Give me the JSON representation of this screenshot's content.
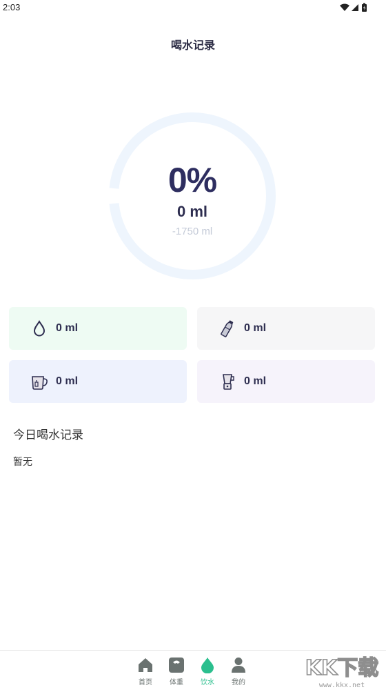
{
  "status_bar": {
    "time": "2:03"
  },
  "header": {
    "title": "喝水记录"
  },
  "progress": {
    "percent_label": "0%",
    "fraction": 0,
    "amount_label": "0 ml",
    "remaining_label": "-1750 ml",
    "ring_color": "#eef5fd"
  },
  "cards": [
    {
      "icon": "water-drop-icon",
      "value": "0 ml",
      "bg": "#eefbf3"
    },
    {
      "icon": "water-bottle-icon",
      "value": "0 ml",
      "bg": "#f6f6f7"
    },
    {
      "icon": "cup-icon",
      "value": "0 ml",
      "bg": "#eef2fd"
    },
    {
      "icon": "blender-cup-icon",
      "value": "0 ml",
      "bg": "#f6f3fb"
    }
  ],
  "records": {
    "title": "今日喝水记录",
    "empty_text": "暂无"
  },
  "bottom_nav": {
    "items": [
      {
        "label": "首页",
        "icon": "home-icon"
      },
      {
        "label": "体重",
        "icon": "scale-icon"
      },
      {
        "label": "饮水",
        "icon": "water-drop-icon",
        "active": true
      },
      {
        "label": "我的",
        "icon": "person-icon"
      }
    ],
    "active_color": "#2bbf8e",
    "inactive_color": "#6a7270"
  },
  "watermark": {
    "logo_text": "KK下载",
    "url": "www.kkx.net"
  }
}
